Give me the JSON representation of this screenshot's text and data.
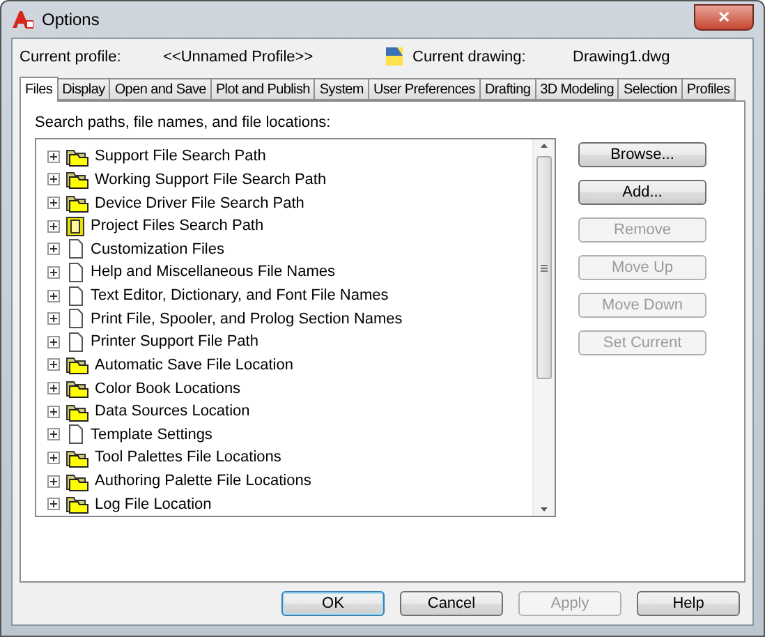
{
  "window": {
    "title": "Options",
    "close": "✕"
  },
  "header": {
    "profile_label": "Current profile:",
    "profile_value": "<<Unnamed Profile>>",
    "drawing_label": "Current drawing:",
    "drawing_value": "Drawing1.dwg"
  },
  "tabs": [
    {
      "label": "Files",
      "selected": true
    },
    {
      "label": "Display",
      "selected": false
    },
    {
      "label": "Open and Save",
      "selected": false
    },
    {
      "label": "Plot and Publish",
      "selected": false
    },
    {
      "label": "System",
      "selected": false
    },
    {
      "label": "User Preferences",
      "selected": false
    },
    {
      "label": "Drafting",
      "selected": false
    },
    {
      "label": "3D Modeling",
      "selected": false
    },
    {
      "label": "Selection",
      "selected": false
    },
    {
      "label": "Profiles",
      "selected": false
    }
  ],
  "tree_caption": "Search paths, file names, and file locations:",
  "tree": [
    {
      "label": "Support File Search Path",
      "kind": "folder",
      "expanded": false
    },
    {
      "label": "Working Support File Search Path",
      "kind": "folder",
      "expanded": false
    },
    {
      "label": "Device Driver File Search Path",
      "kind": "folder",
      "expanded": false
    },
    {
      "label": "Project Files Search Path",
      "kind": "project",
      "expanded": false
    },
    {
      "label": "Customization Files",
      "kind": "file",
      "expanded": false
    },
    {
      "label": "Help and Miscellaneous File Names",
      "kind": "file",
      "expanded": false
    },
    {
      "label": "Text Editor, Dictionary, and Font File Names",
      "kind": "file",
      "expanded": false
    },
    {
      "label": "Print File, Spooler, and Prolog Section Names",
      "kind": "file",
      "expanded": false
    },
    {
      "label": "Printer Support File Path",
      "kind": "file",
      "expanded": false
    },
    {
      "label": "Automatic Save File Location",
      "kind": "folder",
      "expanded": false
    },
    {
      "label": "Color Book Locations",
      "kind": "folder",
      "expanded": false
    },
    {
      "label": "Data Sources Location",
      "kind": "folder",
      "expanded": false
    },
    {
      "label": "Template Settings",
      "kind": "file",
      "expanded": false
    },
    {
      "label": "Tool Palettes File Locations",
      "kind": "folder",
      "expanded": false
    },
    {
      "label": "Authoring Palette File Locations",
      "kind": "folder",
      "expanded": false
    },
    {
      "label": "Log File Location",
      "kind": "folder",
      "expanded": false
    }
  ],
  "side_buttons": [
    {
      "label": "Browse...",
      "disabled": false
    },
    {
      "label": "Add...",
      "disabled": false
    },
    {
      "label": "Remove",
      "disabled": true
    },
    {
      "label": "Move Up",
      "disabled": true
    },
    {
      "label": "Move Down",
      "disabled": true
    },
    {
      "label": "Set Current",
      "disabled": true
    }
  ],
  "footer_buttons": [
    {
      "label": "OK",
      "disabled": false,
      "default": true
    },
    {
      "label": "Cancel",
      "disabled": false,
      "default": false
    },
    {
      "label": "Apply",
      "disabled": true,
      "default": false
    },
    {
      "label": "Help",
      "disabled": false,
      "default": false
    }
  ]
}
